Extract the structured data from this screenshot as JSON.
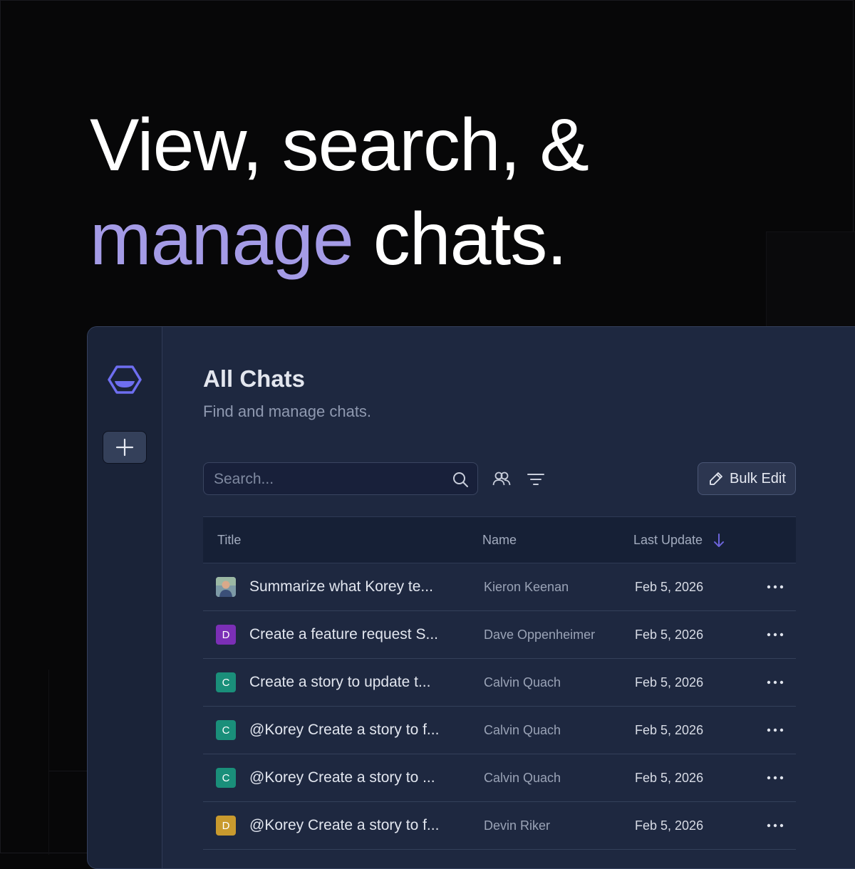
{
  "headline": {
    "line1": "View, search, &",
    "accent": "manage",
    "rest": " chats."
  },
  "colors": {
    "accent": "#a49be6",
    "logo": "#6e6ef0",
    "sort_arrow": "#6b63d9",
    "avatar_purple": "#7b2fb6",
    "avatar_teal": "#1a8f7a",
    "avatar_gold": "#c99a2e"
  },
  "sidebar": {
    "logo_icon": "hexagon-logo-icon",
    "new_button_icon": "plus-icon"
  },
  "page": {
    "title": "All Chats",
    "subtitle": "Find and manage chats."
  },
  "toolbar": {
    "search_placeholder": "Search...",
    "bulk_edit_label": "Bulk Edit"
  },
  "table": {
    "columns": {
      "title": "Title",
      "name": "Name",
      "last_update": "Last Update"
    },
    "sort": "Last Update descending",
    "rows": [
      {
        "avatar": "",
        "avatar_kind": "photo",
        "title": "Summarize what Korey te...",
        "name": "Kieron Keenan",
        "date": "Feb 5, 2026"
      },
      {
        "avatar": "D",
        "avatar_kind": "purple",
        "title": "Create a feature request S...",
        "name": "Dave Oppenheimer",
        "date": "Feb 5, 2026"
      },
      {
        "avatar": "C",
        "avatar_kind": "teal",
        "title": "Create a story to update t...",
        "name": "Calvin Quach",
        "date": "Feb 5, 2026"
      },
      {
        "avatar": "C",
        "avatar_kind": "teal",
        "title": "@Korey Create a story to f...",
        "name": "Calvin Quach",
        "date": "Feb 5, 2026"
      },
      {
        "avatar": "C",
        "avatar_kind": "teal",
        "title": "@Korey Create a story to ...",
        "name": "Calvin Quach",
        "date": "Feb 5, 2026"
      },
      {
        "avatar": "D",
        "avatar_kind": "gold",
        "title": "@Korey Create a story to f...",
        "name": "Devin Riker",
        "date": "Feb 5, 2026"
      }
    ]
  }
}
